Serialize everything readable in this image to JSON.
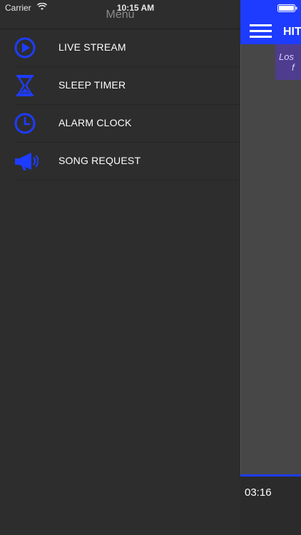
{
  "status_bar": {
    "carrier": "Carrier",
    "time": "10:15 AM"
  },
  "menu": {
    "title": "Menu",
    "items": [
      {
        "label": "LIVE STREAM",
        "icon": "play-circle-icon"
      },
      {
        "label": "SLEEP TIMER",
        "icon": "hourglass-icon"
      },
      {
        "label": "ALARM CLOCK",
        "icon": "clock-icon"
      },
      {
        "label": "SONG REQUEST",
        "icon": "megaphone-icon"
      }
    ]
  },
  "main": {
    "nav_title": "HIT",
    "ad_text_line1": "Los",
    "ad_text_line2": "f",
    "player": {
      "elapsed": "03:16"
    }
  },
  "colors": {
    "accent": "#1e3cff",
    "background": "#2d2d2d",
    "menu_title": "#8a8a8a"
  }
}
